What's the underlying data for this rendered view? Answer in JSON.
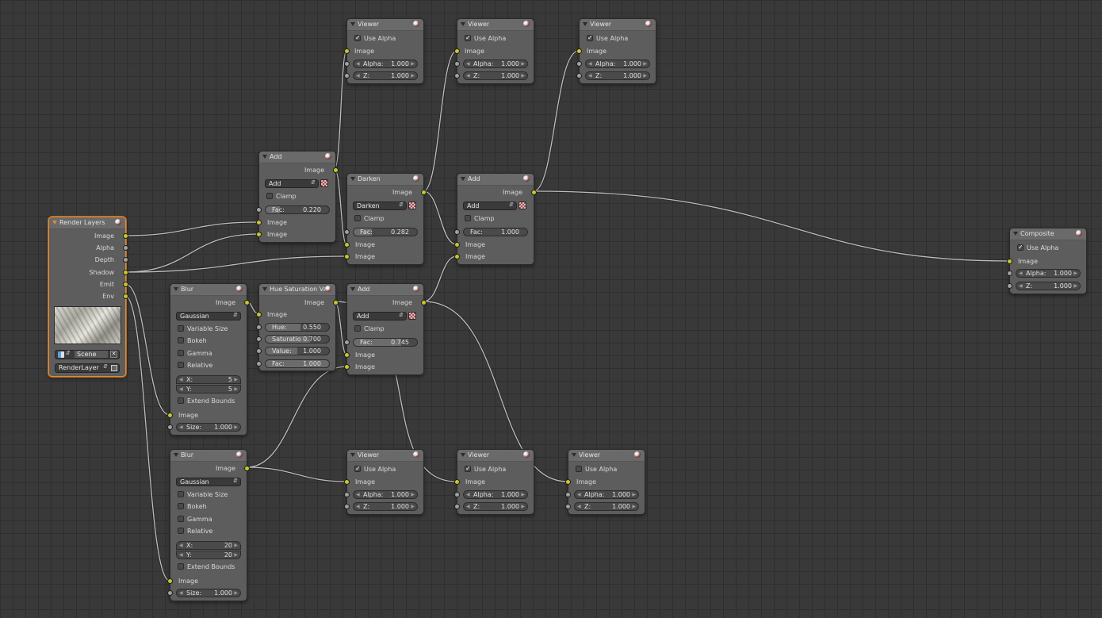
{
  "colors": {
    "background": "#393939",
    "node": "#5d5d5d",
    "socket_image": "#c7c729",
    "socket_value": "#a1a1a1",
    "active_border": "#e08a35"
  },
  "common": {
    "image": "Image",
    "alpha": "Alpha:",
    "z": "Z:",
    "fac": "Fac:",
    "clamp": "Clamp",
    "use_alpha": "Use Alpha",
    "one": "1.000",
    "size": "Size:",
    "x": "X:",
    "y": "Y:",
    "variable_size": "Variable Size",
    "bokeh": "Bokeh",
    "gamma": "Gamma",
    "relative": "Relative",
    "extend_bounds": "Extend Bounds",
    "gaussian": "Gaussian"
  },
  "viewer_title": "Viewer",
  "add_title": "Add",
  "render_layers": {
    "title": "Render Layers",
    "outputs": [
      "Image",
      "Alpha",
      "Depth",
      "Shadow",
      "Emit",
      "Env"
    ],
    "scene": "Scene",
    "layer": "RenderLayer",
    "icon": "render-layer-icon"
  },
  "add_top": {
    "mode": "Add",
    "fac": "0.220"
  },
  "darken": {
    "title": "Darken",
    "mode": "Darken",
    "fac": "0.282"
  },
  "add_right": {
    "mode": "Add",
    "fac": "1.000"
  },
  "add_mid": {
    "mode": "Add",
    "fac": "0.745"
  },
  "hsv": {
    "title": "Hue Saturation Val...",
    "hue_label": "Hue:",
    "hue": "0.550",
    "sat_label": "Saturatio",
    "sat": "0.700",
    "val_label": "Value:",
    "val": "1.000"
  },
  "blur1": {
    "title": "Blur",
    "x": "5",
    "y": "5"
  },
  "blur2": {
    "title": "Blur",
    "x": "20",
    "y": "20"
  },
  "composite": {
    "title": "Composite"
  }
}
